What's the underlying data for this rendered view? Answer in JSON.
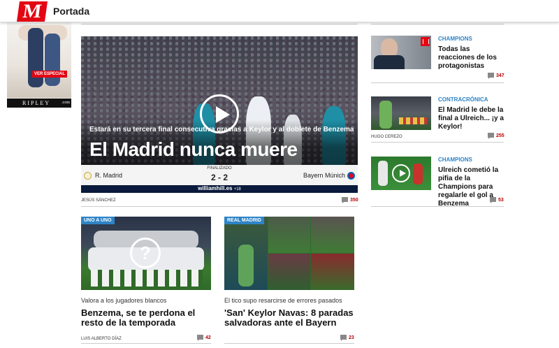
{
  "header": {
    "logo": "M",
    "section": "Portada"
  },
  "ad": {
    "badge": "VER ESPECIAL",
    "brand": "RIPLEY",
    "domain": ".com"
  },
  "hero": {
    "kicker": "Estará en su tercera final consecutiva gracias a Keylor y al doblete de Benzema",
    "headline": "El Madrid nunca muere",
    "status": "FINALIZADO",
    "result": "2 - 2",
    "home": "R. Madrid",
    "away": "Bayern Múnich",
    "sponsor": "williamhill.es",
    "sponsor_note": "+18",
    "author": "JESÚS SÁNCHEZ",
    "comments": "350"
  },
  "cards": [
    {
      "tag": "UNO A UNO",
      "kicker": "Valora a los jugadores blancos",
      "title": "Benzema, se te perdona el resto de la temporada",
      "author": "LUIS ALBERTO DÍAZ",
      "comments": "42"
    },
    {
      "tag": "REAL MADRID",
      "kicker": "El tico supo resarcirse de errores pasados",
      "title": "'San' Keylor Navas: 8 paradas salvadoras ante el Bayern",
      "author": "",
      "comments": "23"
    }
  ],
  "sidebar": [
    {
      "category": "CHAMPIONS",
      "title": "Todas las reacciones de los protagonistas",
      "author": "",
      "comments": "347"
    },
    {
      "category": "CONTRACRÓNICA",
      "title": "El Madrid le debe la final a Ulreich... ¡y a Keylor!",
      "author": "HUGO CEREZO",
      "comments": "255"
    },
    {
      "category": "CHAMPIONS",
      "title": "Ulreich cometió la pifia de la Champions para regalarle el gol a Benzema",
      "author": "",
      "comments": "53"
    }
  ],
  "colors": {
    "brand": "#e30613",
    "category": "#2e84c7",
    "comment_count": "#bb0000"
  }
}
